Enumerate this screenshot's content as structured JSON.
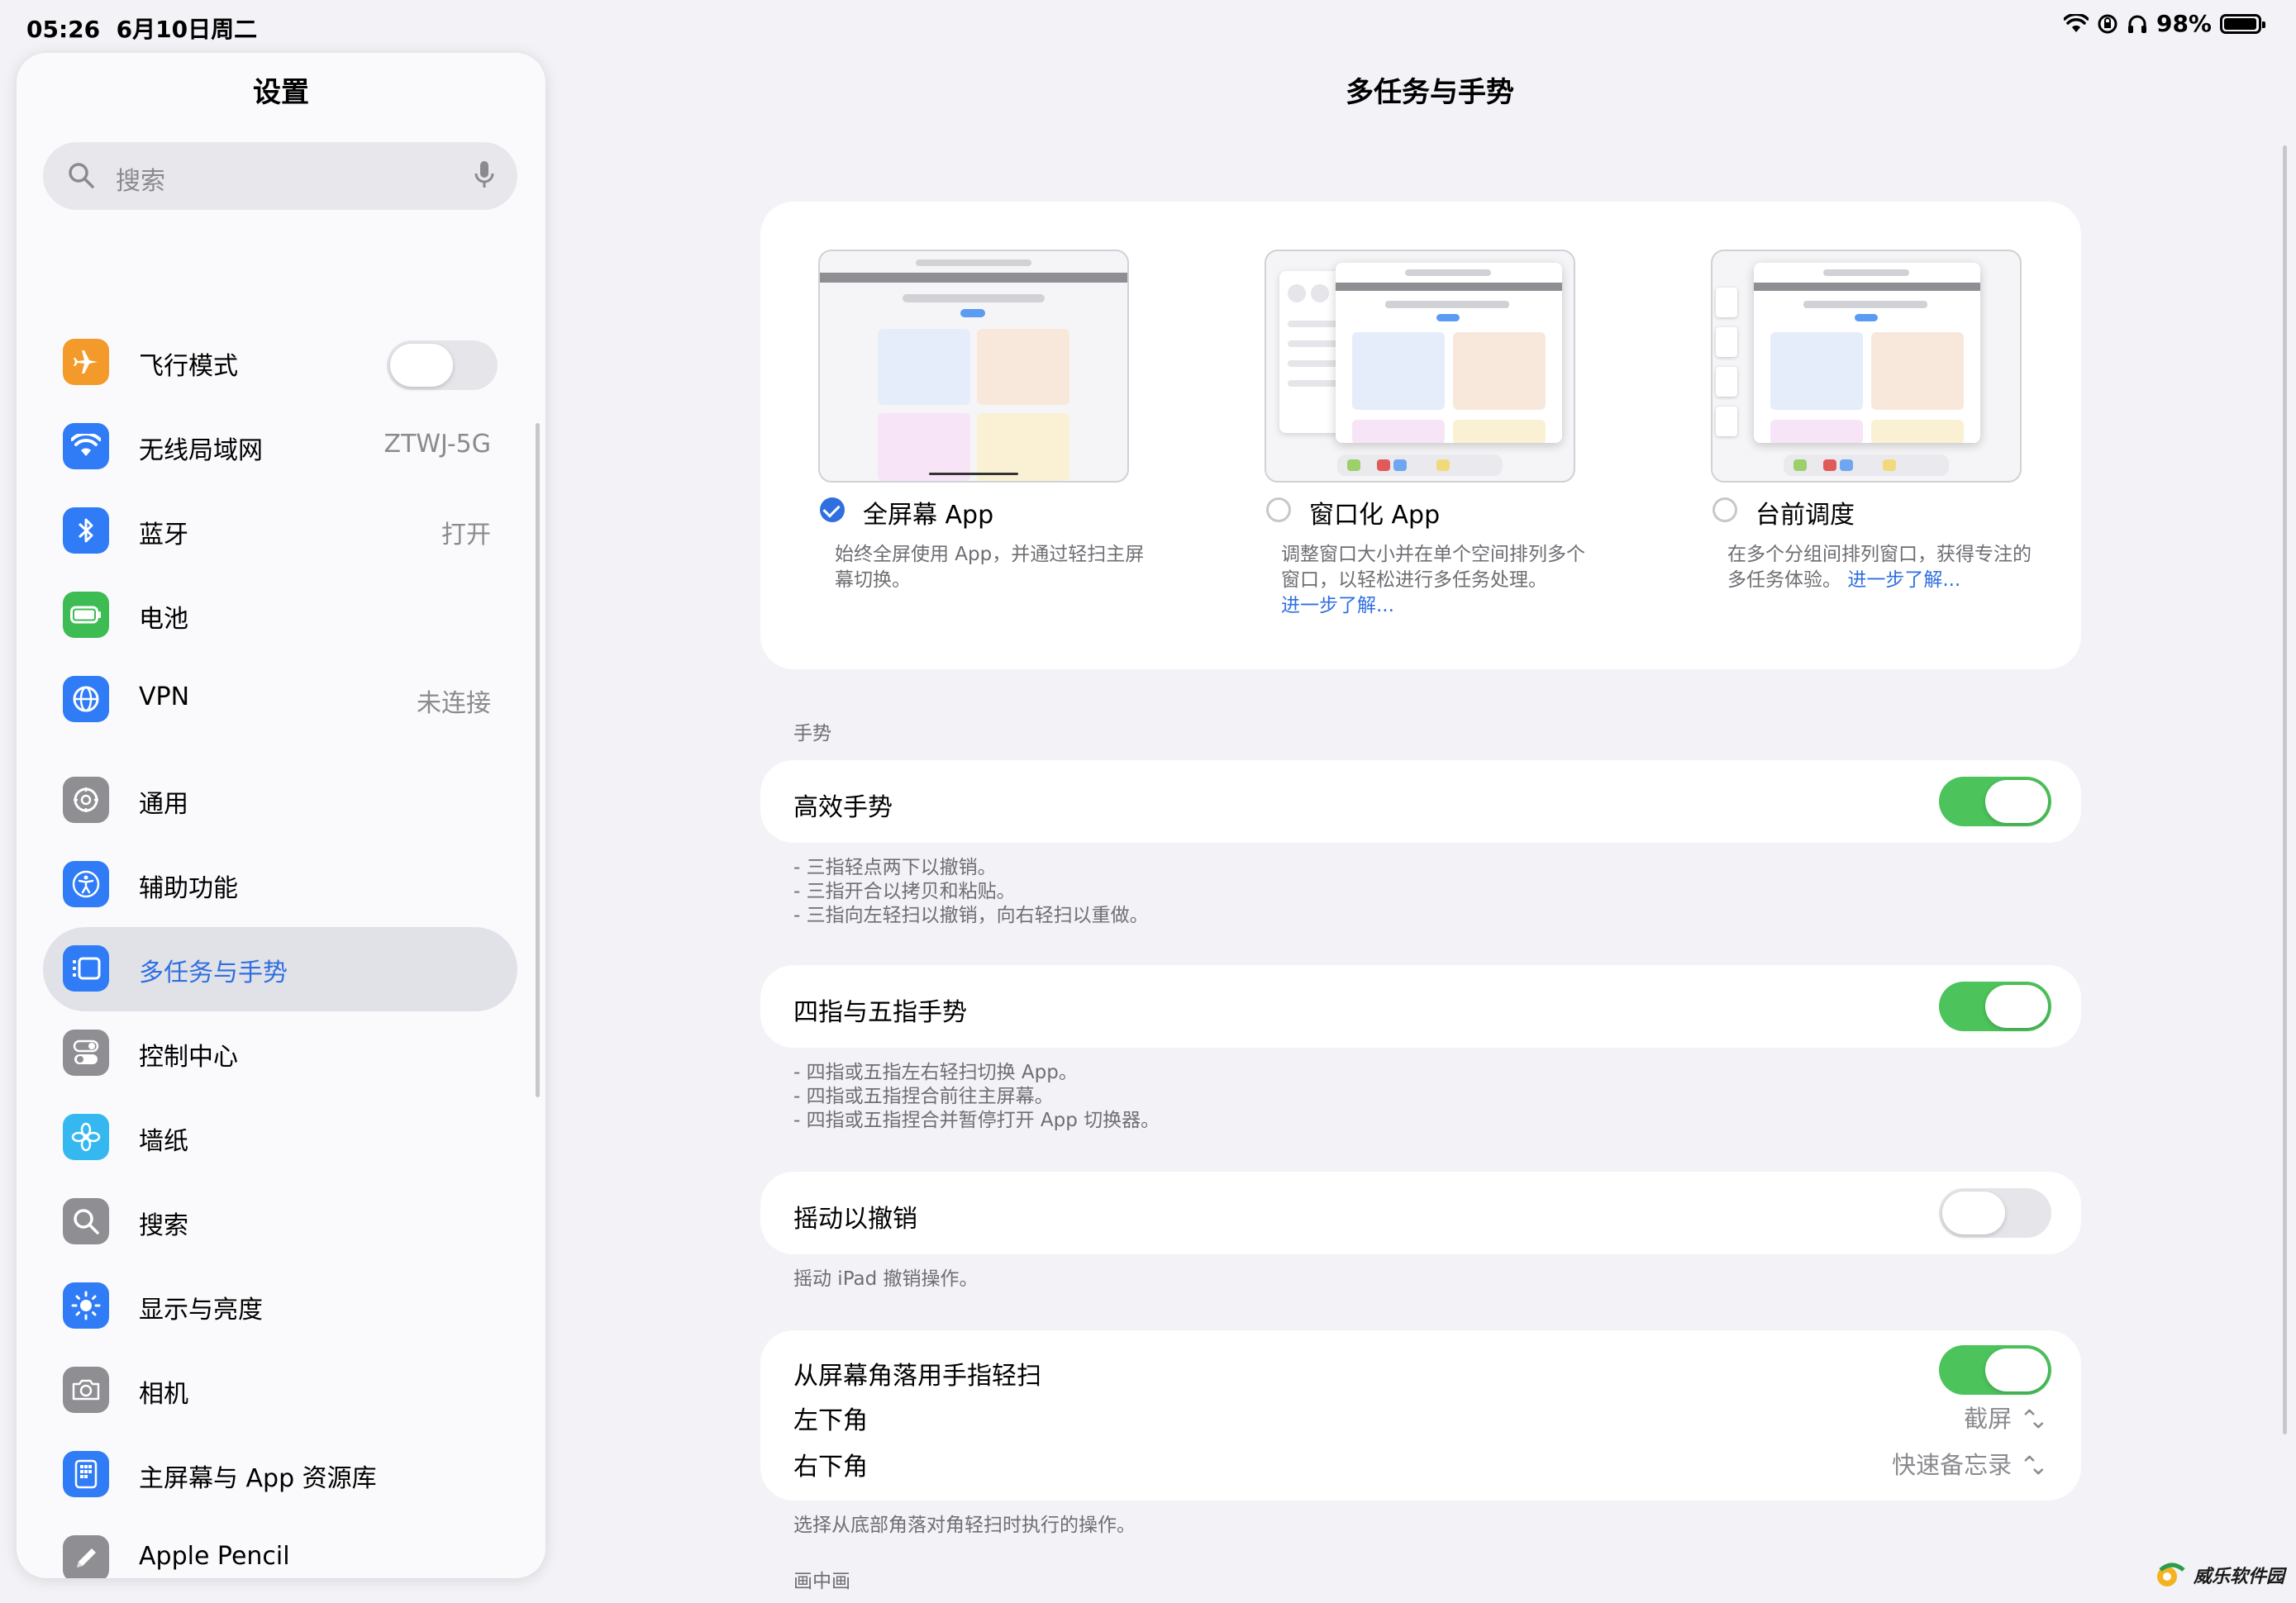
{
  "status": {
    "time": "05:26",
    "date": "6月10日周二",
    "battery": "98%",
    "battery_level": 0.98
  },
  "sidebar": {
    "title": "设置",
    "search_placeholder": "搜索",
    "items": [
      {
        "label": "飞行模式",
        "value": "",
        "toggle": "off",
        "icon": "airplane-icon",
        "color": "#f49a2a"
      },
      {
        "label": "无线局域网",
        "value": "ZTWJ-5G",
        "icon": "wifi-icon",
        "color": "#2f7cf6"
      },
      {
        "label": "蓝牙",
        "value": "打开",
        "icon": "bluetooth-icon",
        "color": "#2f7cf6"
      },
      {
        "label": "电池",
        "value": "",
        "icon": "battery-icon",
        "color": "#3cbc52"
      },
      {
        "label": "VPN",
        "value": "未连接",
        "icon": "globe-icon",
        "color": "#2f7cf6"
      },
      {
        "label": "通用",
        "value": "",
        "icon": "gear-icon",
        "color": "#8e8e93"
      },
      {
        "label": "辅助功能",
        "value": "",
        "icon": "accessibility-icon",
        "color": "#2f7cf6"
      },
      {
        "label": "多任务与手势",
        "value": "",
        "icon": "multitasking-icon",
        "color": "#2f7cf6",
        "selected": true
      },
      {
        "label": "控制中心",
        "value": "",
        "icon": "switches-icon",
        "color": "#8e8e93"
      },
      {
        "label": "墙纸",
        "value": "",
        "icon": "flower-icon",
        "color": "#35b8f0"
      },
      {
        "label": "搜索",
        "value": "",
        "icon": "search-icon",
        "color": "#8e8e93"
      },
      {
        "label": "显示与亮度",
        "value": "",
        "icon": "sun-icon",
        "color": "#2f7cf6"
      },
      {
        "label": "相机",
        "value": "",
        "icon": "camera-icon",
        "color": "#8e8e93"
      },
      {
        "label": "主屏幕与 App 资源库",
        "value": "",
        "icon": "homescreen-icon",
        "color": "#2f7cf6"
      },
      {
        "label": "Apple Pencil",
        "value": "",
        "icon": "pencil-icon",
        "color": "#8e8e93"
      }
    ]
  },
  "main": {
    "title": "多任务与手势",
    "modes": [
      {
        "label": "全屏幕 App",
        "checked": true,
        "desc": "始终全屏使用 App，并通过轻扫主屏幕切换。",
        "link": ""
      },
      {
        "label": "窗口化 App",
        "checked": false,
        "desc": "调整窗口大小并在单个空间排列多个窗口，以轻松进行多任务处理。",
        "link": "进一步了解..."
      },
      {
        "label": "台前调度",
        "checked": false,
        "desc": "在多个分组间排列窗口，获得专注的多任务体验。",
        "link": "进一步了解..."
      }
    ],
    "gestures_header": "手势",
    "efficient": {
      "label": "高效手势",
      "on": true,
      "footer": [
        "- 三指轻点两下以撤销。",
        "- 三指开合以拷贝和粘贴。",
        "- 三指向左轻扫以撤销，向右轻扫以重做。"
      ]
    },
    "fourfive": {
      "label": "四指与五指手势",
      "on": true,
      "footer": [
        "- 四指或五指左右轻扫切换 App。",
        "- 四指或五指捏合前往主屏幕。",
        "- 四指或五指捏合并暂停打开 App 切换器。"
      ]
    },
    "shake": {
      "label": "摇动以撤销",
      "on": false,
      "footer": "摇动 iPad 撤销操作。"
    },
    "corner": {
      "label": "从屏幕角落用手指轻扫",
      "on": true,
      "left_label": "左下角",
      "left_value": "截屏",
      "right_label": "右下角",
      "right_value": "快速备忘录",
      "footer": "选择从底部角落对角轻扫时执行的操作。"
    },
    "pip_header": "画中画"
  },
  "watermark": "威乐软件园"
}
